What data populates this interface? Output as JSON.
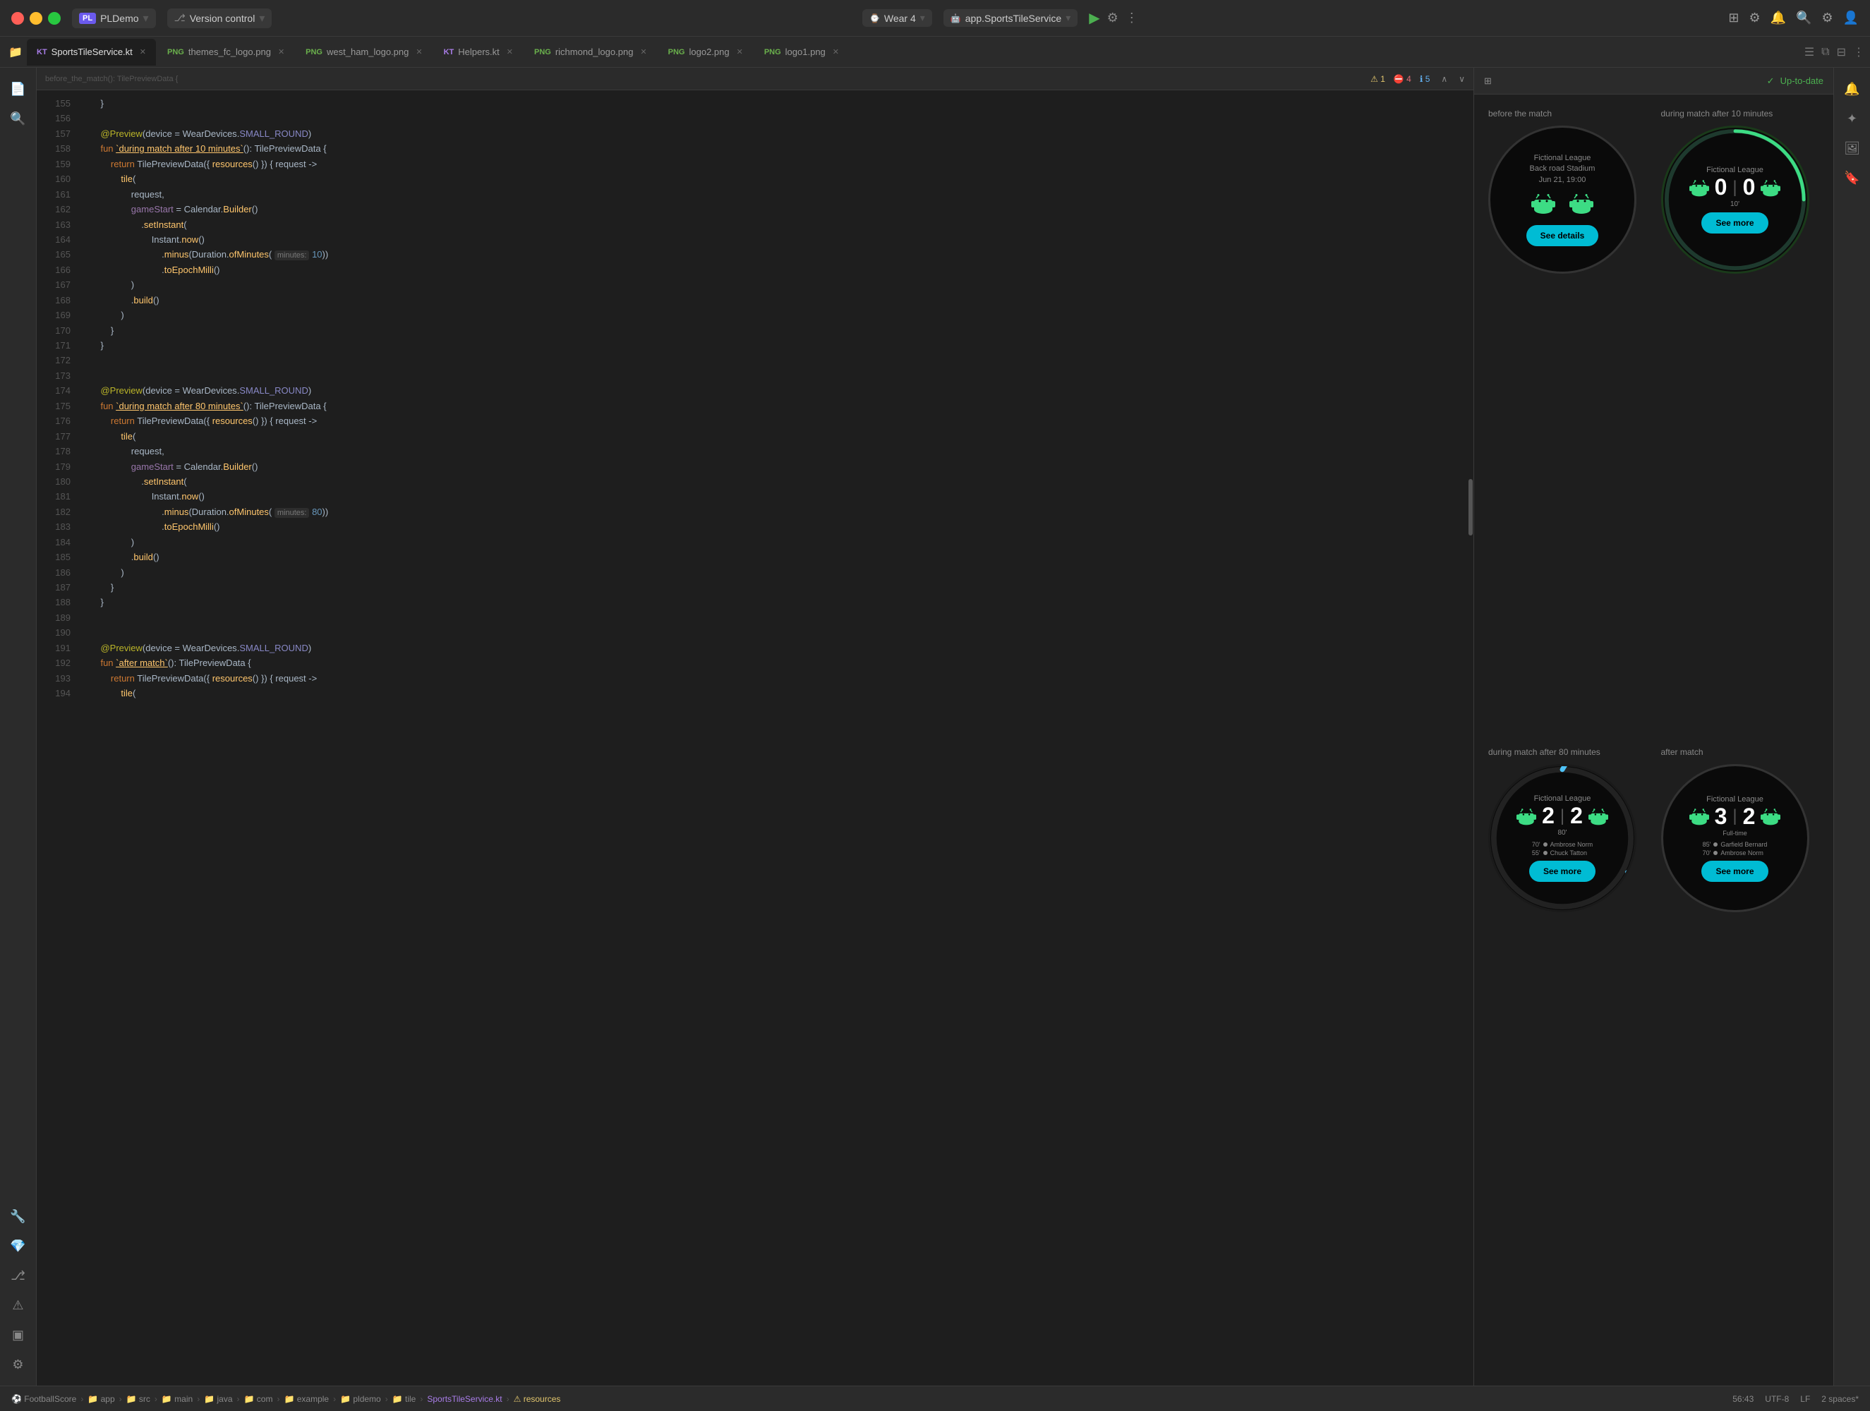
{
  "titlebar": {
    "app_name": "PLDemo",
    "app_badge": "PL",
    "version_control": "Version control",
    "wear_label": "Wear 4",
    "service_label": "app.SportsTileService",
    "run_icon": "▶",
    "debug_icon": "⚙",
    "more_icon": "⋮",
    "icons": [
      "search",
      "settings",
      "person"
    ]
  },
  "tabs": [
    {
      "label": "SportsTileService.kt",
      "type": "kt",
      "active": true
    },
    {
      "label": "themes_fc_logo.png",
      "type": "png",
      "active": false
    },
    {
      "label": "west_ham_logo.png",
      "type": "png",
      "active": false
    },
    {
      "label": "Helpers.kt",
      "type": "kt",
      "active": false
    },
    {
      "label": "richmond_logo.png",
      "type": "png",
      "active": false
    },
    {
      "label": "logo2.png",
      "type": "png",
      "active": false
    },
    {
      "label": "logo1.png",
      "type": "png",
      "active": false
    }
  ],
  "code": {
    "warning_badge": "⚠1",
    "error_badge": "⛔4",
    "info_badge": "ℹ5",
    "lines": [
      {
        "num": 155,
        "content": "    }"
      },
      {
        "num": 156,
        "content": ""
      },
      {
        "num": 157,
        "content": "    @Preview(device = WearDevices.SMALL_ROUND)",
        "has_annotation": true
      },
      {
        "num": 158,
        "content": "    fun `during match after 10 minutes`(): TilePreviewData {"
      },
      {
        "num": 159,
        "content": "        return TilePreviewData({ resources() }) { request ->"
      },
      {
        "num": 160,
        "content": "            tile("
      },
      {
        "num": 161,
        "content": "                request,"
      },
      {
        "num": 162,
        "content": "                gameStart = Calendar.Builder()"
      },
      {
        "num": 163,
        "content": "                    .setInstant("
      },
      {
        "num": 164,
        "content": "                        Instant.now()"
      },
      {
        "num": 165,
        "content": "                            .minus(Duration.ofMinutes( minutes: 10))"
      },
      {
        "num": 166,
        "content": "                            .toEpochMilli()"
      },
      {
        "num": 167,
        "content": "                )"
      },
      {
        "num": 168,
        "content": "                .build()"
      },
      {
        "num": 169,
        "content": "            )"
      },
      {
        "num": 170,
        "content": "        }"
      },
      {
        "num": 171,
        "content": "    }"
      },
      {
        "num": 172,
        "content": ""
      },
      {
        "num": 173,
        "content": ""
      },
      {
        "num": 174,
        "content": "    @Preview(device = WearDevices.SMALL_ROUND)",
        "has_annotation": true
      },
      {
        "num": 175,
        "content": "    fun `during match after 80 minutes`(): TilePreviewData {"
      },
      {
        "num": 176,
        "content": "        return TilePreviewData({ resources() }) { request ->"
      },
      {
        "num": 177,
        "content": "            tile("
      },
      {
        "num": 178,
        "content": "                request,"
      },
      {
        "num": 179,
        "content": "                gameStart = Calendar.Builder()"
      },
      {
        "num": 180,
        "content": "                    .setInstant("
      },
      {
        "num": 181,
        "content": "                        Instant.now()"
      },
      {
        "num": 182,
        "content": "                            .minus(Duration.ofMinutes( minutes: 80))"
      },
      {
        "num": 183,
        "content": "                            .toEpochMilli()"
      },
      {
        "num": 184,
        "content": "                )"
      },
      {
        "num": 185,
        "content": "                .build()"
      },
      {
        "num": 186,
        "content": "            )"
      },
      {
        "num": 187,
        "content": "        }"
      },
      {
        "num": 188,
        "content": "    }"
      },
      {
        "num": 189,
        "content": ""
      },
      {
        "num": 190,
        "content": ""
      },
      {
        "num": 191,
        "content": "    @Preview(device = WearDevices.SMALL_ROUND)",
        "has_annotation": true
      },
      {
        "num": 192,
        "content": "    fun `after match`(): TilePreviewData {"
      },
      {
        "num": 193,
        "content": "        return TilePreviewData({ resources() }) { request ->"
      },
      {
        "num": 194,
        "content": "            tile("
      }
    ]
  },
  "preview": {
    "toolbar_icon": "⊞",
    "up_to_date": "Up-to-date",
    "panels": [
      {
        "label": "before the match",
        "type": "before",
        "league": "Fictional League",
        "stadium": "Back road Stadium",
        "date": "Jun 21, 19:00",
        "button_label": "See details"
      },
      {
        "label": "during match after 10 minutes",
        "type": "during_10",
        "league": "Fictional League",
        "score_home": "0",
        "score_away": "0",
        "minute": "10'",
        "button_label": "See more"
      },
      {
        "label": "during match after 80 minutes",
        "type": "during_80",
        "league": "Fictional League",
        "score_home": "2",
        "score_away": "2",
        "minute": "80'",
        "scorer1_min": "70'",
        "scorer1_name": "Ambrose Norm",
        "scorer2_min": "55'",
        "scorer2_name": "Chuck Tatton",
        "button_label": "See more"
      },
      {
        "label": "after match",
        "type": "after",
        "league": "Fictional League",
        "score_home": "3",
        "score_away": "2",
        "status": "Full-time",
        "scorer1_min": "85'",
        "scorer1_name": "Garfield Bernard",
        "scorer2_min": "70'",
        "scorer2_name": "Ambrose Norm",
        "button_label": "See more"
      }
    ]
  },
  "statusbar": {
    "path_items": [
      "FootballScore",
      "app",
      "src",
      "main",
      "java",
      "com",
      "example",
      "pldemo",
      "tile",
      "SportsTileService.kt",
      "resources"
    ],
    "position": "56:43",
    "encoding": "UTF-8",
    "line_ending": "LF",
    "indent": "2 spaces*"
  }
}
